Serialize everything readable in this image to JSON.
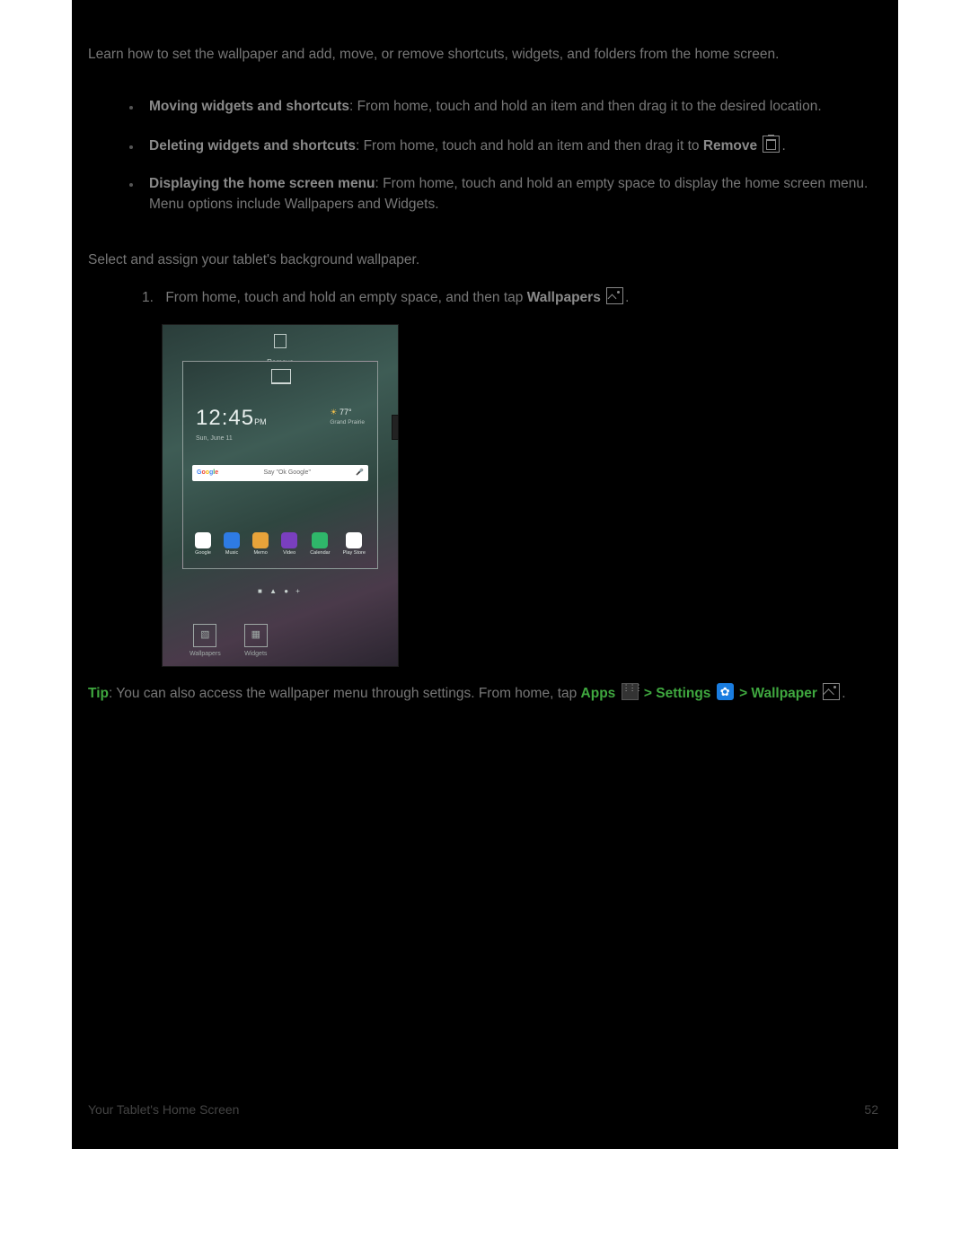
{
  "intro": "Learn how to set the wallpaper and add, move, or remove shortcuts, widgets, and folders from the home screen.",
  "bullets": [
    {
      "title": "Moving widgets and shortcuts",
      "text": ": From home, touch and hold an item and then drag it to the desired location."
    },
    {
      "title": "Deleting widgets and shortcuts",
      "text": ": From home, touch and hold an item and then drag it to ",
      "trailing_bold": "Remove",
      "trailing_icon": "trash",
      "trailing_period": "."
    },
    {
      "title": "Displaying the home screen menu",
      "text": ": From home, touch and hold an empty space to display the home screen menu. Menu options include Wallpapers and Widgets."
    }
  ],
  "wallpaper_intro": "Select and assign your tablet's background wallpaper.",
  "step1_num": "1.",
  "step1_text_a": "From home, touch and hold an empty space, and then tap ",
  "step1_bold": "Wallpapers",
  "step1_period": ".",
  "tip": {
    "label": "Tip",
    "text_a": ": You can also access the wallpaper menu through settings. From home, tap ",
    "apps": "Apps",
    "sep1": " > ",
    "settings": "Settings",
    "sep2": " > ",
    "wallpaper": "Wallpaper",
    "period": "."
  },
  "screenshot": {
    "remove": "Remove",
    "time": "12:45",
    "pm": "PM",
    "date": "Sun, June 11",
    "temp": "77°",
    "city": "Grand Prairie",
    "google": "Google",
    "search_hint": "Say \"Ok Google\"",
    "apps": [
      {
        "label": "Google",
        "bg": "#ffffff"
      },
      {
        "label": "Music",
        "bg": "#2e7be4"
      },
      {
        "label": "Memo",
        "bg": "#e8a33a"
      },
      {
        "label": "Video",
        "bg": "#7a3fbf"
      },
      {
        "label": "Calendar",
        "bg": "#2fb76a"
      },
      {
        "label": "Play Store",
        "bg": "#ffffff"
      }
    ],
    "bottom": [
      {
        "label": "Wallpapers"
      },
      {
        "label": "Widgets"
      }
    ]
  },
  "footer_left": "Your Tablet's Home Screen",
  "footer_right": "52"
}
